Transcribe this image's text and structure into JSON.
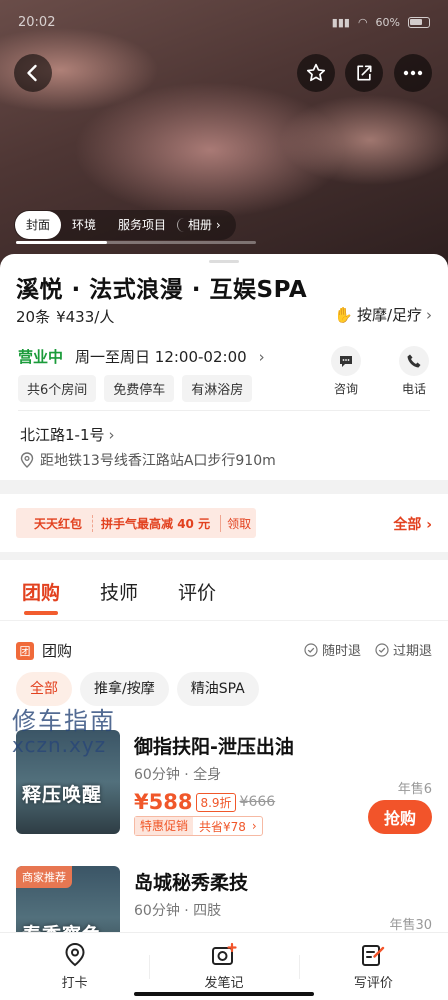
{
  "status_bar": {
    "time": "20:02",
    "battery": "60%"
  },
  "hero": {
    "tabs": [
      {
        "label": "封面",
        "active": true
      },
      {
        "label": "环境",
        "active": false
      },
      {
        "label": "服务项目",
        "active": false
      },
      {
        "label": "相册",
        "active": false
      }
    ],
    "progress": 0.38,
    "icons": [
      "back-icon",
      "star-icon",
      "share-icon",
      "more-icon"
    ]
  },
  "shop": {
    "title": "溪悦 · 法式浪漫 · 互娱SPA",
    "reviews": "20条",
    "avg_price": "¥433/人",
    "category": "按摩/足疗",
    "open_status": "营业中",
    "hours": "周一至周日 12:00-02:00",
    "tags": [
      "共6个房间",
      "免费停车",
      "有淋浴房"
    ],
    "actions": {
      "consult": "咨询",
      "phone": "电话"
    },
    "address": "北江路1-1号",
    "route": "距地铁13号线香江路站A口步行910m"
  },
  "coupon": {
    "name": "天天红包",
    "desc": "拼手气最高减 40 元",
    "claim": "领取",
    "all": "全部"
  },
  "deals_section": {
    "tabs": [
      {
        "label": "团购",
        "active": true
      },
      {
        "label": "技师",
        "active": false
      },
      {
        "label": "评价",
        "active": false
      }
    ],
    "section_badge": "团",
    "section_title": "团购",
    "guarantees": [
      "随时退",
      "过期退"
    ],
    "chips": [
      {
        "label": "全部",
        "active": true
      },
      {
        "label": "推拿/按摩",
        "active": false
      },
      {
        "label": "精油SPA",
        "active": false
      }
    ],
    "items": [
      {
        "title": "御指扶阳-泄压出油",
        "spec": "60分钟 · 全身",
        "price": "¥588",
        "discount": "8.9折",
        "original": "¥666",
        "promo_tag": "特惠促销",
        "promo_save": "共省¥78",
        "sold": "年售6",
        "buy": "抢购",
        "image_text": "释压唤醒",
        "badge": ""
      },
      {
        "title": "岛城秘秀柔技",
        "spec": "60分钟 · 四肢",
        "sold": "年售30",
        "image_text": "春季察色",
        "badge": "商家推荐"
      }
    ]
  },
  "watermark": {
    "line1": "修车指南",
    "line2": "xczn.xyz"
  },
  "bottom_nav": [
    {
      "label": "打卡",
      "icon": "location-pin-icon"
    },
    {
      "label": "发笔记",
      "icon": "camera-plus-icon"
    },
    {
      "label": "写评价",
      "icon": "write-review-icon"
    }
  ],
  "colors": {
    "accent": "#f2542a",
    "open": "#1a9b3a"
  }
}
